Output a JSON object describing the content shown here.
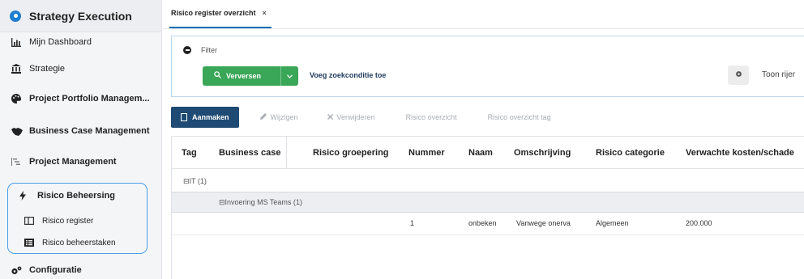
{
  "app": {
    "title": "Strategy Execution"
  },
  "sidebar": {
    "items": [
      {
        "label": "Mijn Dashboard",
        "icon": "bar-chart-icon"
      },
      {
        "label": "Strategie",
        "icon": "bank-icon"
      },
      {
        "label": "Project Portfolio Managem...",
        "icon": "palette-icon"
      },
      {
        "label": "Business Case Management",
        "icon": "handshake-icon"
      },
      {
        "label": "Project Management",
        "icon": "gantt-icon"
      }
    ],
    "risk_group": {
      "label": "Risico Beheersing",
      "icon": "bolt-icon",
      "children": [
        {
          "label": "Risico register",
          "icon": "register-icon"
        },
        {
          "label": "Risico beheerstaken",
          "icon": "tasks-icon"
        }
      ]
    },
    "config": {
      "label": "Configuratie",
      "icon": "cogs-icon"
    }
  },
  "tabs": [
    {
      "label": "Risico register overzicht",
      "close": "×"
    }
  ],
  "filter": {
    "label": "Filter",
    "refresh_label": "Verversen",
    "add_condition": "Voeg zoekconditie toe",
    "show_rows": "Toon rijer"
  },
  "toolbar": {
    "create": "Aanmaken",
    "edit": "Wijzigen",
    "delete": "Verwijderen",
    "overview": "Risico overzicht",
    "overview_tag": "Risico overzicht tag"
  },
  "table": {
    "columns": [
      "Tag",
      "Business case",
      "Risico groepering",
      "Nummer",
      "Naam",
      "Omschrijving",
      "Risico categorie",
      "Verwachte kosten/schade"
    ],
    "group_1": "IT (1)",
    "group_2": "Invoering MS Teams (1)",
    "row": {
      "nummer": "1",
      "naam": "onbeken",
      "omschrijving": "Vanwege onerva",
      "categorie": "Algemeen",
      "kosten": "200.000"
    }
  },
  "colors": {
    "accent": "#1f4a73",
    "success": "#3aa657",
    "focus": "#4a9fe8"
  }
}
